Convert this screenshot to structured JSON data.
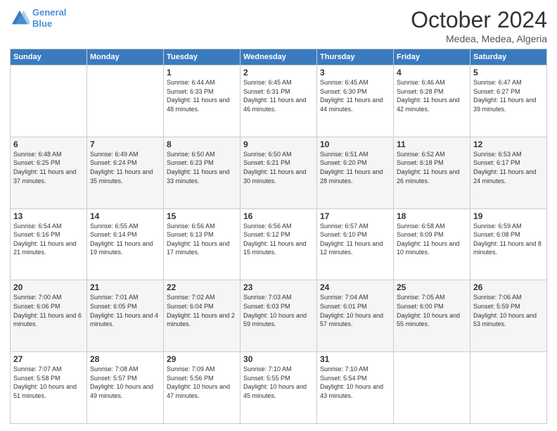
{
  "header": {
    "logo_line1": "General",
    "logo_line2": "Blue",
    "month": "October 2024",
    "location": "Medea, Medea, Algeria"
  },
  "weekdays": [
    "Sunday",
    "Monday",
    "Tuesday",
    "Wednesday",
    "Thursday",
    "Friday",
    "Saturday"
  ],
  "weeks": [
    [
      {
        "day": "",
        "sunrise": "",
        "sunset": "",
        "daylight": ""
      },
      {
        "day": "",
        "sunrise": "",
        "sunset": "",
        "daylight": ""
      },
      {
        "day": "1",
        "sunrise": "Sunrise: 6:44 AM",
        "sunset": "Sunset: 6:33 PM",
        "daylight": "Daylight: 11 hours and 48 minutes."
      },
      {
        "day": "2",
        "sunrise": "Sunrise: 6:45 AM",
        "sunset": "Sunset: 6:31 PM",
        "daylight": "Daylight: 11 hours and 46 minutes."
      },
      {
        "day": "3",
        "sunrise": "Sunrise: 6:45 AM",
        "sunset": "Sunset: 6:30 PM",
        "daylight": "Daylight: 11 hours and 44 minutes."
      },
      {
        "day": "4",
        "sunrise": "Sunrise: 6:46 AM",
        "sunset": "Sunset: 6:28 PM",
        "daylight": "Daylight: 11 hours and 42 minutes."
      },
      {
        "day": "5",
        "sunrise": "Sunrise: 6:47 AM",
        "sunset": "Sunset: 6:27 PM",
        "daylight": "Daylight: 11 hours and 39 minutes."
      }
    ],
    [
      {
        "day": "6",
        "sunrise": "Sunrise: 6:48 AM",
        "sunset": "Sunset: 6:25 PM",
        "daylight": "Daylight: 11 hours and 37 minutes."
      },
      {
        "day": "7",
        "sunrise": "Sunrise: 6:49 AM",
        "sunset": "Sunset: 6:24 PM",
        "daylight": "Daylight: 11 hours and 35 minutes."
      },
      {
        "day": "8",
        "sunrise": "Sunrise: 6:50 AM",
        "sunset": "Sunset: 6:23 PM",
        "daylight": "Daylight: 11 hours and 33 minutes."
      },
      {
        "day": "9",
        "sunrise": "Sunrise: 6:50 AM",
        "sunset": "Sunset: 6:21 PM",
        "daylight": "Daylight: 11 hours and 30 minutes."
      },
      {
        "day": "10",
        "sunrise": "Sunrise: 6:51 AM",
        "sunset": "Sunset: 6:20 PM",
        "daylight": "Daylight: 11 hours and 28 minutes."
      },
      {
        "day": "11",
        "sunrise": "Sunrise: 6:52 AM",
        "sunset": "Sunset: 6:18 PM",
        "daylight": "Daylight: 11 hours and 26 minutes."
      },
      {
        "day": "12",
        "sunrise": "Sunrise: 6:53 AM",
        "sunset": "Sunset: 6:17 PM",
        "daylight": "Daylight: 11 hours and 24 minutes."
      }
    ],
    [
      {
        "day": "13",
        "sunrise": "Sunrise: 6:54 AM",
        "sunset": "Sunset: 6:16 PM",
        "daylight": "Daylight: 11 hours and 21 minutes."
      },
      {
        "day": "14",
        "sunrise": "Sunrise: 6:55 AM",
        "sunset": "Sunset: 6:14 PM",
        "daylight": "Daylight: 11 hours and 19 minutes."
      },
      {
        "day": "15",
        "sunrise": "Sunrise: 6:56 AM",
        "sunset": "Sunset: 6:13 PM",
        "daylight": "Daylight: 11 hours and 17 minutes."
      },
      {
        "day": "16",
        "sunrise": "Sunrise: 6:56 AM",
        "sunset": "Sunset: 6:12 PM",
        "daylight": "Daylight: 11 hours and 15 minutes."
      },
      {
        "day": "17",
        "sunrise": "Sunrise: 6:57 AM",
        "sunset": "Sunset: 6:10 PM",
        "daylight": "Daylight: 11 hours and 12 minutes."
      },
      {
        "day": "18",
        "sunrise": "Sunrise: 6:58 AM",
        "sunset": "Sunset: 6:09 PM",
        "daylight": "Daylight: 11 hours and 10 minutes."
      },
      {
        "day": "19",
        "sunrise": "Sunrise: 6:59 AM",
        "sunset": "Sunset: 6:08 PM",
        "daylight": "Daylight: 11 hours and 8 minutes."
      }
    ],
    [
      {
        "day": "20",
        "sunrise": "Sunrise: 7:00 AM",
        "sunset": "Sunset: 6:06 PM",
        "daylight": "Daylight: 11 hours and 6 minutes."
      },
      {
        "day": "21",
        "sunrise": "Sunrise: 7:01 AM",
        "sunset": "Sunset: 6:05 PM",
        "daylight": "Daylight: 11 hours and 4 minutes."
      },
      {
        "day": "22",
        "sunrise": "Sunrise: 7:02 AM",
        "sunset": "Sunset: 6:04 PM",
        "daylight": "Daylight: 11 hours and 2 minutes."
      },
      {
        "day": "23",
        "sunrise": "Sunrise: 7:03 AM",
        "sunset": "Sunset: 6:03 PM",
        "daylight": "Daylight: 10 hours and 59 minutes."
      },
      {
        "day": "24",
        "sunrise": "Sunrise: 7:04 AM",
        "sunset": "Sunset: 6:01 PM",
        "daylight": "Daylight: 10 hours and 57 minutes."
      },
      {
        "day": "25",
        "sunrise": "Sunrise: 7:05 AM",
        "sunset": "Sunset: 6:00 PM",
        "daylight": "Daylight: 10 hours and 55 minutes."
      },
      {
        "day": "26",
        "sunrise": "Sunrise: 7:06 AM",
        "sunset": "Sunset: 5:59 PM",
        "daylight": "Daylight: 10 hours and 53 minutes."
      }
    ],
    [
      {
        "day": "27",
        "sunrise": "Sunrise: 7:07 AM",
        "sunset": "Sunset: 5:58 PM",
        "daylight": "Daylight: 10 hours and 51 minutes."
      },
      {
        "day": "28",
        "sunrise": "Sunrise: 7:08 AM",
        "sunset": "Sunset: 5:57 PM",
        "daylight": "Daylight: 10 hours and 49 minutes."
      },
      {
        "day": "29",
        "sunrise": "Sunrise: 7:09 AM",
        "sunset": "Sunset: 5:56 PM",
        "daylight": "Daylight: 10 hours and 47 minutes."
      },
      {
        "day": "30",
        "sunrise": "Sunrise: 7:10 AM",
        "sunset": "Sunset: 5:55 PM",
        "daylight": "Daylight: 10 hours and 45 minutes."
      },
      {
        "day": "31",
        "sunrise": "Sunrise: 7:10 AM",
        "sunset": "Sunset: 5:54 PM",
        "daylight": "Daylight: 10 hours and 43 minutes."
      },
      {
        "day": "",
        "sunrise": "",
        "sunset": "",
        "daylight": ""
      },
      {
        "day": "",
        "sunrise": "",
        "sunset": "",
        "daylight": ""
      }
    ]
  ]
}
